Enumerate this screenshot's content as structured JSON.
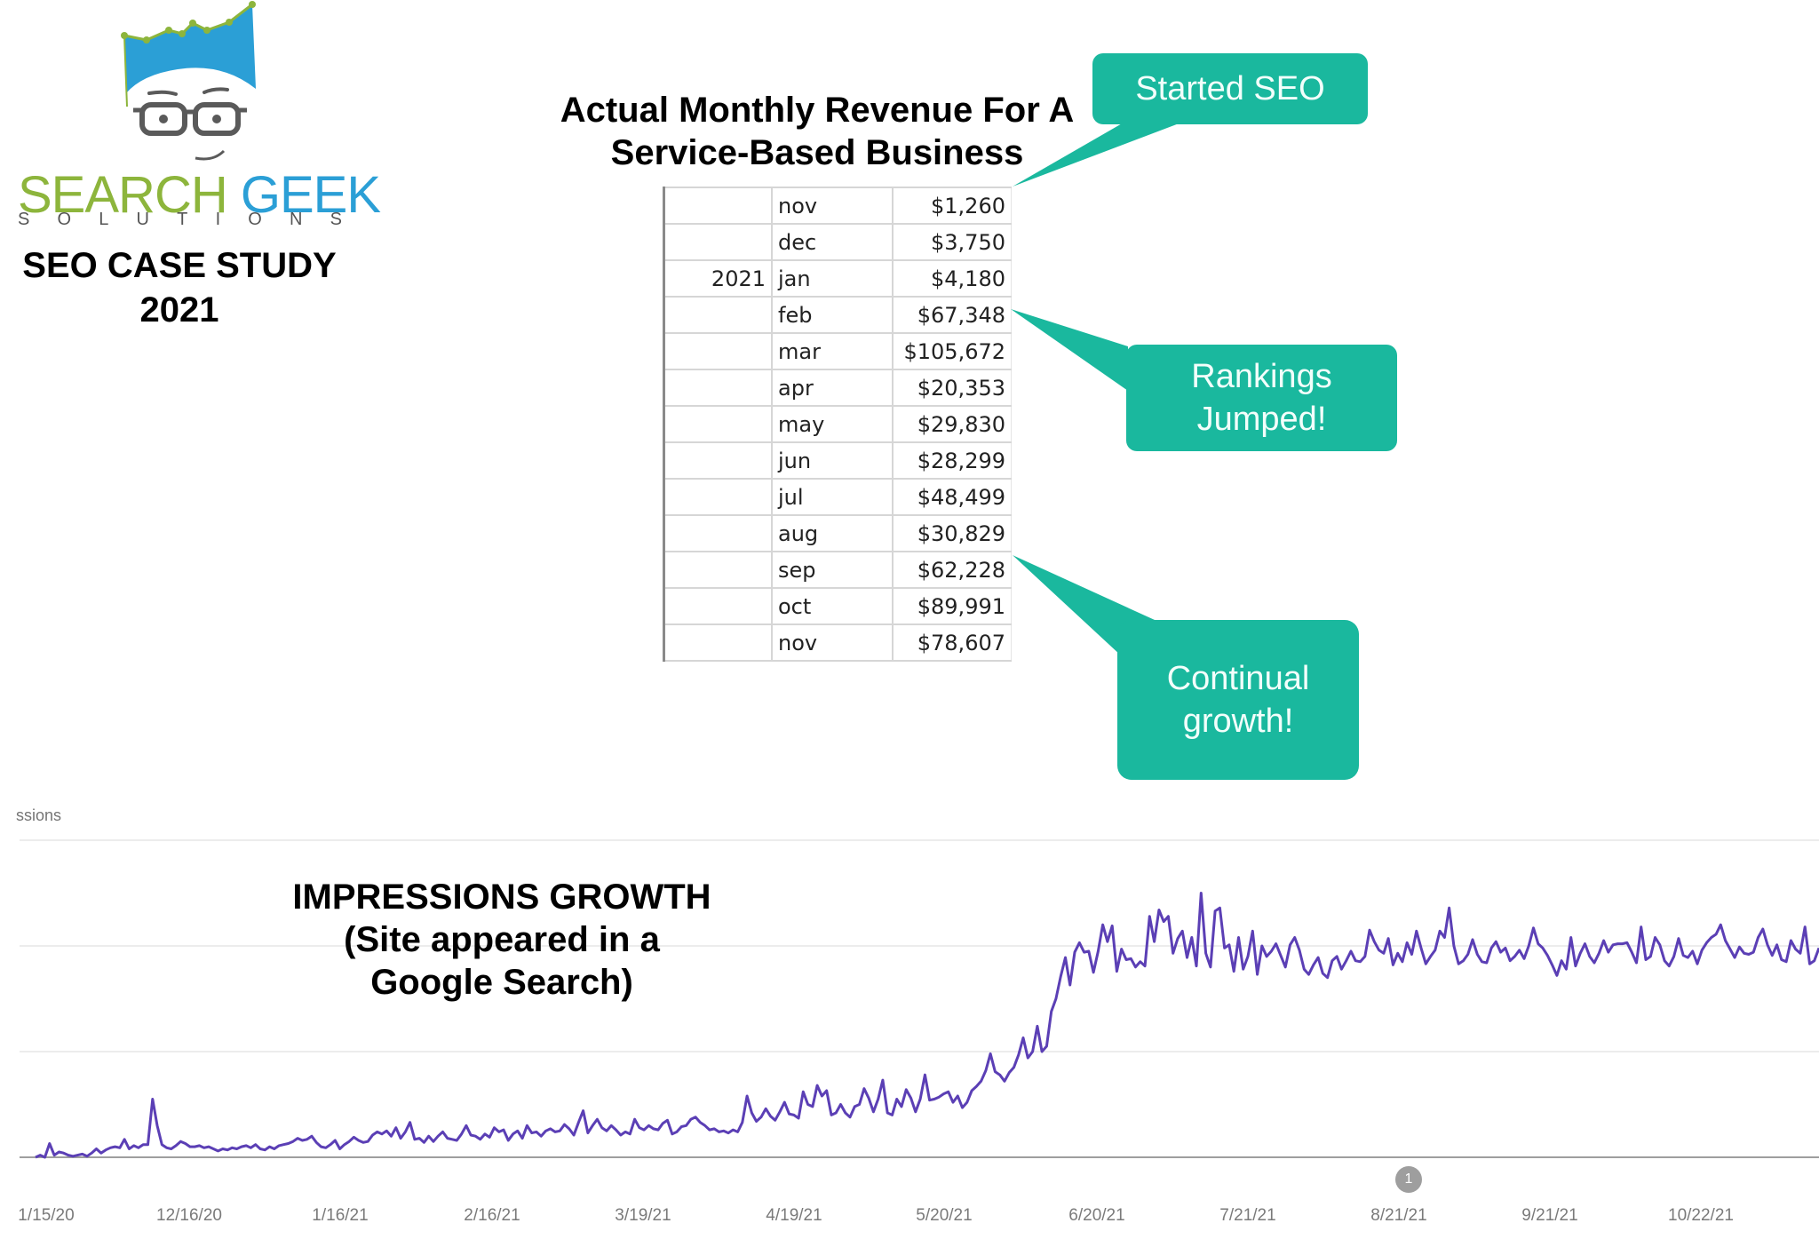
{
  "logo": {
    "brand_part1": "SEARCH",
    "brand_part2": "GEEK",
    "subtitle_letters": [
      "S",
      "O",
      "L",
      "U",
      "T",
      "I",
      "O",
      "N",
      "S"
    ],
    "colors": {
      "hair": "#2b9fd6",
      "accent_green": "#8db53c",
      "glasses": "#5a5a5a"
    }
  },
  "case_study": {
    "line1": "SEO CASE STUDY",
    "line2": "2021"
  },
  "revenue": {
    "title_line1": "Actual Monthly Revenue For A",
    "title_line2": "Service-Based Business",
    "rows": [
      {
        "year": "",
        "month": "nov",
        "amount": "$1,260"
      },
      {
        "year": "",
        "month": "dec",
        "amount": "$3,750"
      },
      {
        "year": "2021",
        "month": "jan",
        "amount": "$4,180"
      },
      {
        "year": "",
        "month": "feb",
        "amount": "$67,348"
      },
      {
        "year": "",
        "month": "mar",
        "amount": "$105,672"
      },
      {
        "year": "",
        "month": "apr",
        "amount": "$20,353"
      },
      {
        "year": "",
        "month": "may",
        "amount": "$29,830"
      },
      {
        "year": "",
        "month": "jun",
        "amount": "$28,299"
      },
      {
        "year": "",
        "month": "jul",
        "amount": "$48,499"
      },
      {
        "year": "",
        "month": "aug",
        "amount": "$30,829"
      },
      {
        "year": "",
        "month": "sep",
        "amount": "$62,228"
      },
      {
        "year": "",
        "month": "oct",
        "amount": "$89,991"
      },
      {
        "year": "",
        "month": "nov",
        "amount": "$78,607"
      }
    ]
  },
  "callouts": {
    "color": "#1ab89e",
    "started_seo": "Started SEO",
    "rankings_line1": "Rankings",
    "rankings_line2": "Jumped!",
    "growth_line1": "Continual",
    "growth_line2": "growth!"
  },
  "chart_data": {
    "type": "line",
    "title": "IMPRESSIONS GROWTH",
    "subtitle_line1": "(Site appeared in a",
    "subtitle_line2": "Google Search)",
    "ylabel_partial": "ssions",
    "series_name": "Impressions",
    "line_color": "#5b3fb5",
    "grid": true,
    "y_units": "gridline units (no tick labels shown)",
    "ylim": [
      0,
      3
    ],
    "x_tick_labels": [
      "1/15/20",
      "12/16/20",
      "1/16/21",
      "2/16/21",
      "3/19/21",
      "4/19/21",
      "5/20/21",
      "6/20/21",
      "7/21/21",
      "8/21/21",
      "9/21/21",
      "10/22/21"
    ],
    "x_range_days": [
      0,
      372
    ],
    "annotation_marker": "1",
    "annotation_day": 279,
    "values": [
      0.0,
      0.02,
      0.0,
      0.13,
      0.02,
      0.05,
      0.04,
      0.02,
      0.01,
      0.02,
      0.03,
      0.01,
      0.04,
      0.08,
      0.04,
      0.07,
      0.09,
      0.1,
      0.09,
      0.17,
      0.08,
      0.11,
      0.09,
      0.12,
      0.12,
      0.55,
      0.3,
      0.12,
      0.09,
      0.08,
      0.11,
      0.15,
      0.13,
      0.1,
      0.1,
      0.11,
      0.09,
      0.1,
      0.08,
      0.06,
      0.08,
      0.07,
      0.09,
      0.08,
      0.1,
      0.11,
      0.09,
      0.12,
      0.08,
      0.07,
      0.1,
      0.08,
      0.11,
      0.12,
      0.13,
      0.15,
      0.18,
      0.16,
      0.17,
      0.2,
      0.14,
      0.1,
      0.09,
      0.12,
      0.16,
      0.08,
      0.12,
      0.15,
      0.19,
      0.16,
      0.14,
      0.15,
      0.21,
      0.24,
      0.22,
      0.25,
      0.2,
      0.28,
      0.18,
      0.24,
      0.33,
      0.17,
      0.18,
      0.14,
      0.2,
      0.15,
      0.2,
      0.24,
      0.18,
      0.17,
      0.16,
      0.22,
      0.3,
      0.21,
      0.2,
      0.17,
      0.22,
      0.19,
      0.28,
      0.24,
      0.26,
      0.16,
      0.22,
      0.25,
      0.18,
      0.3,
      0.23,
      0.24,
      0.2,
      0.25,
      0.27,
      0.24,
      0.25,
      0.31,
      0.27,
      0.21,
      0.33,
      0.44,
      0.23,
      0.3,
      0.36,
      0.28,
      0.25,
      0.3,
      0.26,
      0.21,
      0.24,
      0.22,
      0.36,
      0.28,
      0.26,
      0.3,
      0.27,
      0.26,
      0.32,
      0.35,
      0.22,
      0.24,
      0.29,
      0.3,
      0.36,
      0.38,
      0.33,
      0.3,
      0.26,
      0.27,
      0.24,
      0.25,
      0.23,
      0.26,
      0.24,
      0.33,
      0.58,
      0.42,
      0.34,
      0.38,
      0.46,
      0.39,
      0.35,
      0.43,
      0.52,
      0.41,
      0.4,
      0.37,
      0.62,
      0.5,
      0.48,
      0.68,
      0.58,
      0.63,
      0.4,
      0.42,
      0.5,
      0.42,
      0.38,
      0.48,
      0.5,
      0.65,
      0.56,
      0.43,
      0.55,
      0.73,
      0.42,
      0.4,
      0.55,
      0.48,
      0.64,
      0.56,
      0.43,
      0.55,
      0.78,
      0.54,
      0.55,
      0.57,
      0.6,
      0.62,
      0.52,
      0.58,
      0.47,
      0.52,
      0.63,
      0.67,
      0.72,
      0.82,
      0.98,
      0.81,
      0.78,
      0.72,
      0.8,
      0.85,
      0.97,
      1.13,
      0.94,
      1.0,
      1.24,
      1.0,
      1.05,
      1.38,
      1.5,
      1.71,
      1.89,
      1.63,
      1.94,
      2.03,
      1.94,
      1.95,
      1.75,
      1.95,
      2.2,
      2.04,
      2.19,
      1.76,
      1.97,
      1.87,
      1.88,
      1.8,
      1.85,
      1.81,
      2.28,
      2.04,
      2.34,
      2.23,
      2.28,
      1.93,
      2.07,
      2.14,
      1.89,
      2.08,
      1.81,
      2.5,
      1.93,
      1.8,
      2.33,
      2.36,
      1.98,
      2.01,
      1.76,
      2.08,
      1.78,
      1.9,
      2.14,
      1.73,
      2.0,
      1.9,
      1.95,
      2.02,
      1.91,
      1.8,
      2.01,
      2.08,
      1.96,
      1.78,
      1.73,
      1.82,
      1.89,
      1.74,
      1.7,
      1.86,
      1.9,
      1.78,
      1.86,
      1.95,
      1.86,
      1.85,
      1.9,
      2.15,
      2.04,
      1.96,
      1.93,
      2.07,
      1.82,
      1.93,
      1.85,
      2.03,
      1.92,
      2.14,
      1.98,
      1.83,
      1.9,
      1.96,
      2.14,
      2.08,
      2.36,
      2.0,
      1.83,
      1.86,
      1.92,
      2.06,
      1.92,
      1.85,
      1.84,
      1.98,
      2.04,
      1.94,
      1.98,
      1.86,
      1.9,
      1.96,
      1.88,
      2.0,
      2.17,
      2.02,
      1.98,
      1.91,
      1.82,
      1.72,
      1.86,
      1.78,
      2.08,
      1.81,
      1.93,
      2.02,
      1.9,
      1.84,
      1.93,
      2.05,
      1.94,
      2.01,
      2.02,
      2.02,
      2.03,
      1.94,
      1.84,
      2.18,
      1.87,
      1.9,
      2.08,
      2.01,
      1.86,
      1.81,
      1.9,
      2.07,
      1.91,
      1.89,
      1.95,
      1.83,
      1.96,
      2.03,
      2.08,
      2.11,
      2.2,
      2.05,
      1.97,
      1.89,
      1.99,
      1.93,
      1.92,
      1.94,
      2.08,
      2.16,
      2.01,
      1.91,
      2.01,
      1.87,
      1.85,
      2.05,
      1.97,
      1.93,
      2.18,
      1.83,
      1.86,
      1.98
    ]
  }
}
